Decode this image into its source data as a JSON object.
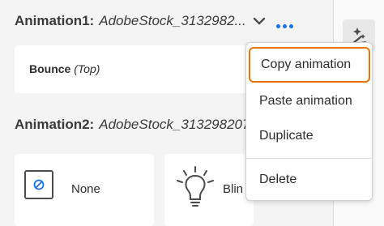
{
  "animation1": {
    "label": "Animation1:",
    "value": "AdobeStock_3132982..."
  },
  "animation1_card": {
    "name": "Bounce",
    "direction": "(Top)"
  },
  "animation2": {
    "label": "Animation2:",
    "value": "AdobeStock_313298207"
  },
  "options": [
    {
      "label": "None",
      "icon": "none-icon"
    },
    {
      "label": "Blin",
      "icon": "lightbulb-icon"
    }
  ],
  "menu": {
    "items": [
      "Copy animation",
      "Paste animation",
      "Duplicate",
      "Delete"
    ],
    "focused": "Copy animation"
  },
  "colors": {
    "accent": "#1473e6",
    "focus_ring": "#e8750b"
  }
}
